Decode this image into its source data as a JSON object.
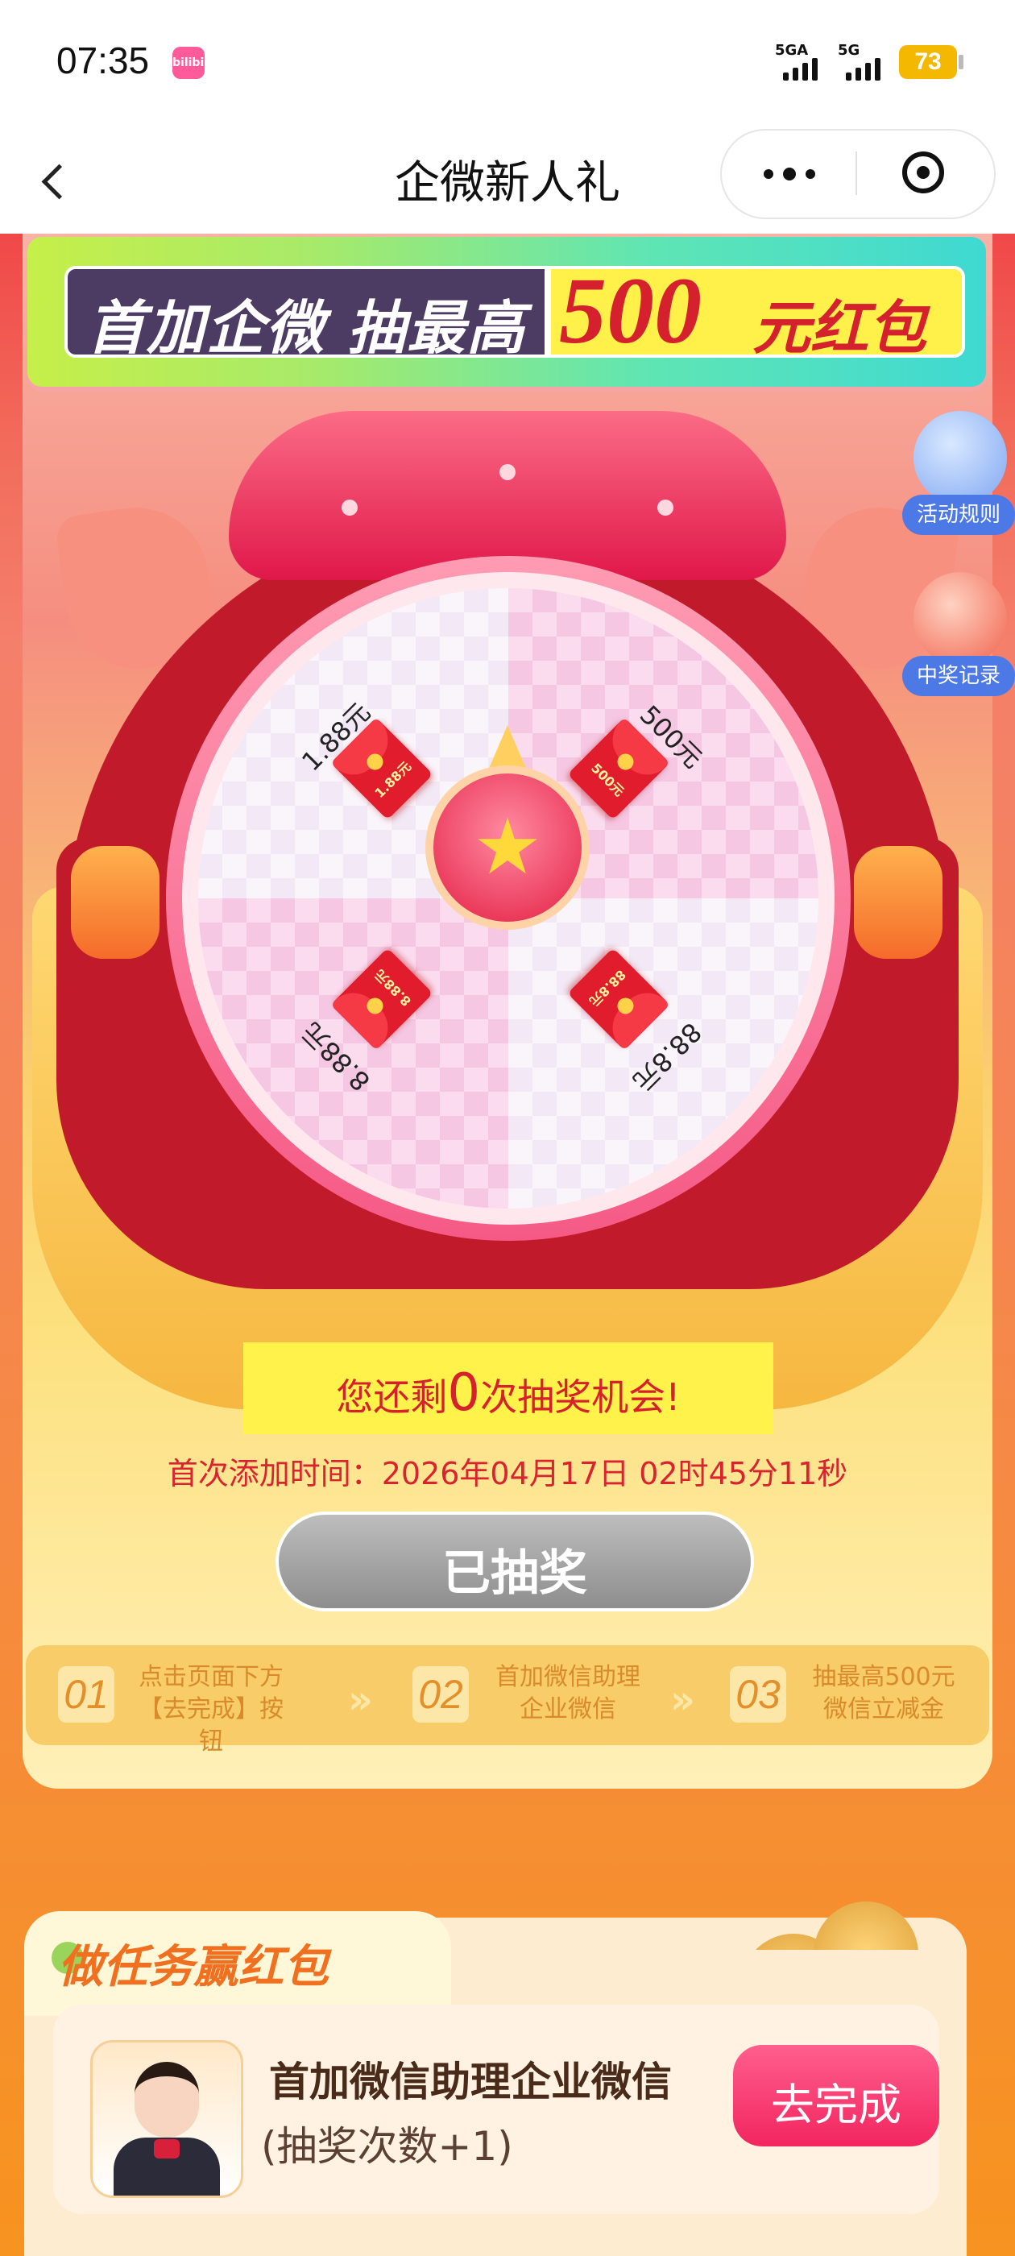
{
  "status_bar": {
    "time": "07:35",
    "app_icon_text": "bilibili",
    "net1": "5GA",
    "net2": "5G",
    "battery": "73"
  },
  "nav": {
    "title": "企微新人礼"
  },
  "hero": {
    "left_text": "首加企微 抽最高",
    "amount": "500",
    "suffix": "元红包"
  },
  "side": {
    "rules_label": "活动规则",
    "records_label": "中奖记录"
  },
  "wheel": {
    "prizes": [
      {
        "label": "1.88元",
        "packet": "1.88元"
      },
      {
        "label": "500元",
        "packet": "500元"
      },
      {
        "label": "8.88元",
        "packet": "8.88元"
      },
      {
        "label": "88.8元",
        "packet": "88.8元"
      }
    ]
  },
  "chances": {
    "prefix": "您还剩",
    "count": "0",
    "suffix": "次抽奖机会!"
  },
  "first_add_time": "首次添加时间：2026年04月17日 02时45分11秒",
  "draw_button": "已抽奖",
  "steps": [
    {
      "num": "01",
      "line1": "点击页面下方",
      "line2": "【去完成】按钮"
    },
    {
      "num": "02",
      "line1": "首加微信助理",
      "line2": "企业微信"
    },
    {
      "num": "03",
      "line1": "抽最高500元",
      "line2": "微信立减金"
    }
  ],
  "tasks": {
    "section_title": "做任务赢红包",
    "item": {
      "name": "首加微信助理企业微信",
      "sub": "(抽奖次数+1)",
      "action": "去完成"
    }
  }
}
